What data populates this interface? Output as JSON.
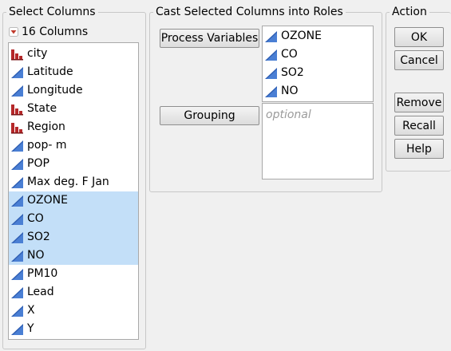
{
  "select_columns": {
    "title": "Select Columns",
    "count_label": "16 Columns",
    "items": [
      {
        "label": "city",
        "icon": "nominal-bar-icon",
        "selected": false
      },
      {
        "label": "Latitude",
        "icon": "continuous-triangle-icon",
        "selected": false
      },
      {
        "label": "Longitude",
        "icon": "continuous-triangle-icon",
        "selected": false
      },
      {
        "label": "State",
        "icon": "nominal-bar-icon",
        "selected": false
      },
      {
        "label": "Region",
        "icon": "nominal-bar-icon",
        "selected": false
      },
      {
        "label": "pop- m",
        "icon": "continuous-triangle-icon",
        "selected": false
      },
      {
        "label": "POP",
        "icon": "continuous-triangle-icon",
        "selected": false
      },
      {
        "label": "Max deg. F Jan",
        "icon": "continuous-triangle-icon",
        "selected": false
      },
      {
        "label": "OZONE",
        "icon": "continuous-triangle-icon",
        "selected": true
      },
      {
        "label": "CO",
        "icon": "continuous-triangle-icon",
        "selected": true
      },
      {
        "label": "SO2",
        "icon": "continuous-triangle-icon",
        "selected": true
      },
      {
        "label": "NO",
        "icon": "continuous-triangle-icon",
        "selected": true
      },
      {
        "label": "PM10",
        "icon": "continuous-triangle-icon",
        "selected": false
      },
      {
        "label": "Lead",
        "icon": "continuous-triangle-icon",
        "selected": false
      },
      {
        "label": "X",
        "icon": "continuous-triangle-icon",
        "selected": false
      },
      {
        "label": "Y",
        "icon": "continuous-triangle-icon",
        "selected": false
      }
    ]
  },
  "cast_roles": {
    "title": "Cast Selected Columns into Roles",
    "process_button": "Process Variables",
    "process_items": [
      {
        "label": "OZONE",
        "icon": "continuous-triangle-icon"
      },
      {
        "label": "CO",
        "icon": "continuous-triangle-icon"
      },
      {
        "label": "SO2",
        "icon": "continuous-triangle-icon"
      },
      {
        "label": "NO",
        "icon": "continuous-triangle-icon"
      }
    ],
    "grouping_button": "Grouping",
    "grouping_placeholder": "optional"
  },
  "action": {
    "title": "Action",
    "ok": "OK",
    "cancel": "Cancel",
    "remove": "Remove",
    "recall": "Recall",
    "help": "Help"
  },
  "colors": {
    "selected_row": "#c3dff8",
    "continuous_icon": "#2f5fb3",
    "nominal_icon": "#b5282a"
  }
}
